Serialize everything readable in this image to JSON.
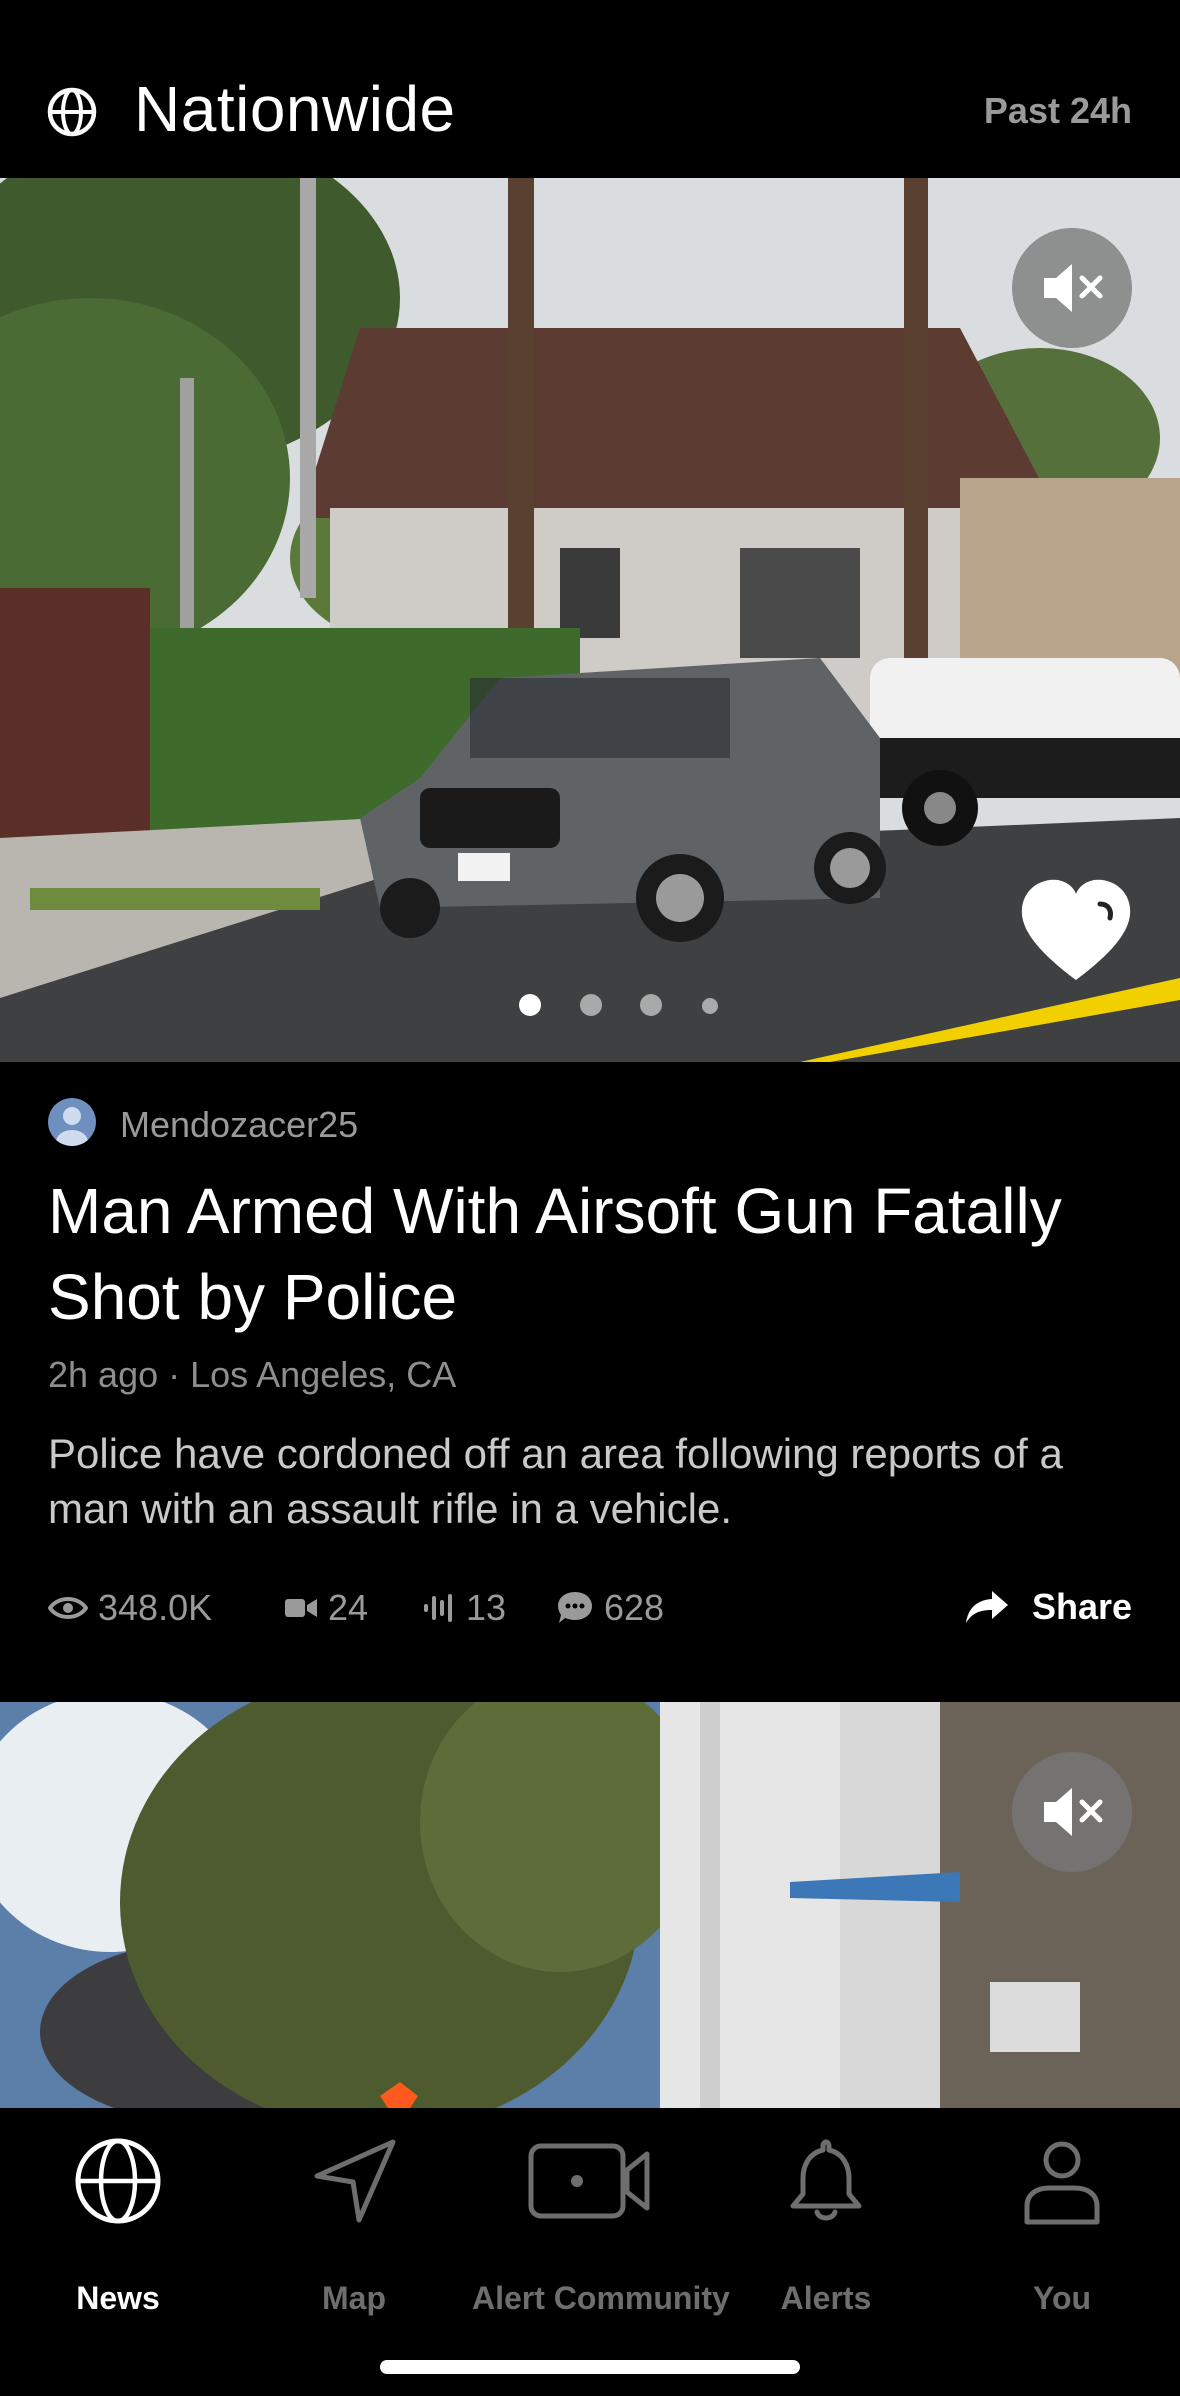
{
  "header": {
    "title": "Nationwide",
    "period": "Past 24h",
    "icon": "globe-icon"
  },
  "post": {
    "author": "Mendozacer25",
    "headline": "Man Armed With Airsoft Gun Fatally Shot by Police",
    "meta": "2h ago · Los Angeles, CA",
    "summary": "Police have cordoned off an area following reports of a man with an assault rifle in a vehicle.",
    "media_pages": 4,
    "media_active_page": 1,
    "stats": {
      "views": "348.0K",
      "videos": "24",
      "audio": "13",
      "comments": "628"
    },
    "share_label": "Share"
  },
  "tabs": [
    {
      "label": "News",
      "icon": "globe-icon",
      "active": true
    },
    {
      "label": "Map",
      "icon": "navigation-arrow-icon",
      "active": false
    },
    {
      "label": "Alert Community",
      "icon": "camera-icon",
      "active": false
    },
    {
      "label": "Alerts",
      "icon": "bell-icon",
      "active": false
    },
    {
      "label": "You",
      "icon": "person-icon",
      "active": false
    }
  ],
  "colors": {
    "background": "#000000",
    "muted_text": "#9a9a9a",
    "caution_tape": "#f2d000"
  }
}
